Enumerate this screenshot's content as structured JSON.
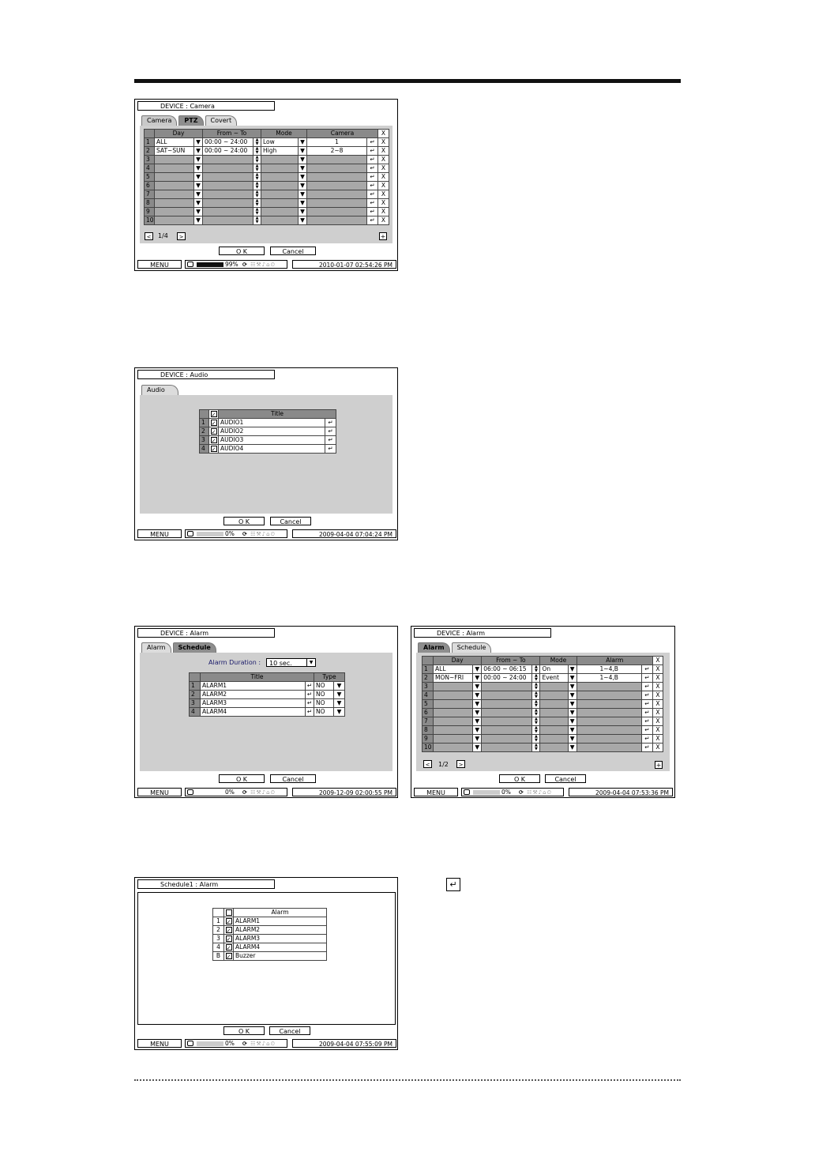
{
  "icons": {
    "enter": "↵",
    "delete": "X",
    "down": "▼",
    "up_down": "▲▼",
    "prev": "<",
    "next": ">",
    "plus": "+",
    "check": "✓",
    "status_icons": "☷⚒♪⌂⏲"
  },
  "camera": {
    "title": "DEVICE : Camera",
    "tabs": [
      "Camera",
      "PTZ",
      "Covert"
    ],
    "headers": {
      "day": "Day",
      "from_to": "From ~ To",
      "mode": "Mode",
      "camera": "Camera",
      "x": "X"
    },
    "rows": [
      {
        "n": "1",
        "day": "ALL",
        "time": "00:00 ~ 24:00",
        "mode": "Low",
        "camera": "1"
      },
      {
        "n": "2",
        "day": "SAT~SUN",
        "time": "00:00 ~ 24:00",
        "mode": "High",
        "camera": "2~8"
      },
      {
        "n": "3",
        "day": "",
        "time": "",
        "mode": "",
        "camera": ""
      },
      {
        "n": "4",
        "day": "",
        "time": "",
        "mode": "",
        "camera": ""
      },
      {
        "n": "5",
        "day": "",
        "time": "",
        "mode": "",
        "camera": ""
      },
      {
        "n": "6",
        "day": "",
        "time": "",
        "mode": "",
        "camera": ""
      },
      {
        "n": "7",
        "day": "",
        "time": "",
        "mode": "",
        "camera": ""
      },
      {
        "n": "8",
        "day": "",
        "time": "",
        "mode": "",
        "camera": ""
      },
      {
        "n": "9",
        "day": "",
        "time": "",
        "mode": "",
        "camera": ""
      },
      {
        "n": "10",
        "day": "",
        "time": "",
        "mode": "",
        "camera": ""
      }
    ],
    "page": "1/4",
    "ok": "O K",
    "cancel": "Cancel",
    "status": {
      "menu": "MENU",
      "disk": "99%",
      "disk_fill": 0.99,
      "clock": "2010-01-07 02:54:26 PM"
    }
  },
  "audio": {
    "title": "DEVICE : Audio",
    "tab": "Audio",
    "header": "Title",
    "rows": [
      {
        "n": "1",
        "title": "AUDIO1"
      },
      {
        "n": "2",
        "title": "AUDIO2"
      },
      {
        "n": "3",
        "title": "AUDIO3"
      },
      {
        "n": "4",
        "title": "AUDIO4"
      }
    ],
    "ok": "O K",
    "cancel": "Cancel",
    "status": {
      "menu": "MENU",
      "disk": "0%",
      "disk_fill": 0,
      "clock": "2009-04-04  07:04:24 PM"
    }
  },
  "alarm": {
    "title": "DEVICE : Alarm",
    "tabs": [
      "Alarm",
      "Schedule"
    ],
    "duration_label": "Alarm Duration :",
    "duration_value": "10 sec.",
    "headers": {
      "title": "Title",
      "type": "Type"
    },
    "rows": [
      {
        "n": "1",
        "title": "ALARM1",
        "type": "NO"
      },
      {
        "n": "2",
        "title": "ALARM2",
        "type": "NO"
      },
      {
        "n": "3",
        "title": "ALARM3",
        "type": "NO"
      },
      {
        "n": "4",
        "title": "ALARM4",
        "type": "NO"
      }
    ],
    "ok": "O K",
    "cancel": "Cancel",
    "status": {
      "menu": "MENU",
      "disk": "0%",
      "disk_fill": 0,
      "clock": "2009-12-09 02:00:55 PM"
    }
  },
  "alarm_schedule": {
    "title": "DEVICE : Alarm",
    "tabs": [
      "Alarm",
      "Schedule"
    ],
    "headers": {
      "day": "Day",
      "from_to": "From ~ To",
      "mode": "Mode",
      "alarm": "Alarm",
      "x": "X"
    },
    "rows": [
      {
        "n": "1",
        "day": "ALL",
        "time": "06:00 ~ 06:15",
        "mode": "On",
        "alarm": "1~4,B"
      },
      {
        "n": "2",
        "day": "MON~FRI",
        "time": "00:00 ~ 24:00",
        "mode": "Event",
        "alarm": "1~4,B"
      },
      {
        "n": "3",
        "day": "",
        "time": "",
        "mode": "",
        "alarm": ""
      },
      {
        "n": "4",
        "day": "",
        "time": "",
        "mode": "",
        "alarm": ""
      },
      {
        "n": "5",
        "day": "",
        "time": "",
        "mode": "",
        "alarm": ""
      },
      {
        "n": "6",
        "day": "",
        "time": "",
        "mode": "",
        "alarm": ""
      },
      {
        "n": "7",
        "day": "",
        "time": "",
        "mode": "",
        "alarm": ""
      },
      {
        "n": "8",
        "day": "",
        "time": "",
        "mode": "",
        "alarm": ""
      },
      {
        "n": "9",
        "day": "",
        "time": "",
        "mode": "",
        "alarm": ""
      },
      {
        "n": "10",
        "day": "",
        "time": "",
        "mode": "",
        "alarm": ""
      }
    ],
    "page": "1/2",
    "ok": "O K",
    "cancel": "Cancel",
    "status": {
      "menu": "MENU",
      "disk": "0%",
      "disk_fill": 0,
      "clock": "2009-04-04  07:53:36 PM"
    }
  },
  "schedule1": {
    "title": "Schedule1 : Alarm",
    "header": "Alarm",
    "rows": [
      {
        "n": "1",
        "title": "ALARM1",
        "checked": true
      },
      {
        "n": "2",
        "title": "ALARM2",
        "checked": true
      },
      {
        "n": "3",
        "title": "ALARM3",
        "checked": true
      },
      {
        "n": "4",
        "title": "ALARM4",
        "checked": true
      },
      {
        "n": "B",
        "title": "Buzzer",
        "checked": true
      }
    ],
    "ok": "O K",
    "cancel": "Cancel",
    "status": {
      "menu": "MENU",
      "disk": "0%",
      "disk_fill": 0,
      "clock": "2009-04-04  07:55:09 PM"
    }
  }
}
